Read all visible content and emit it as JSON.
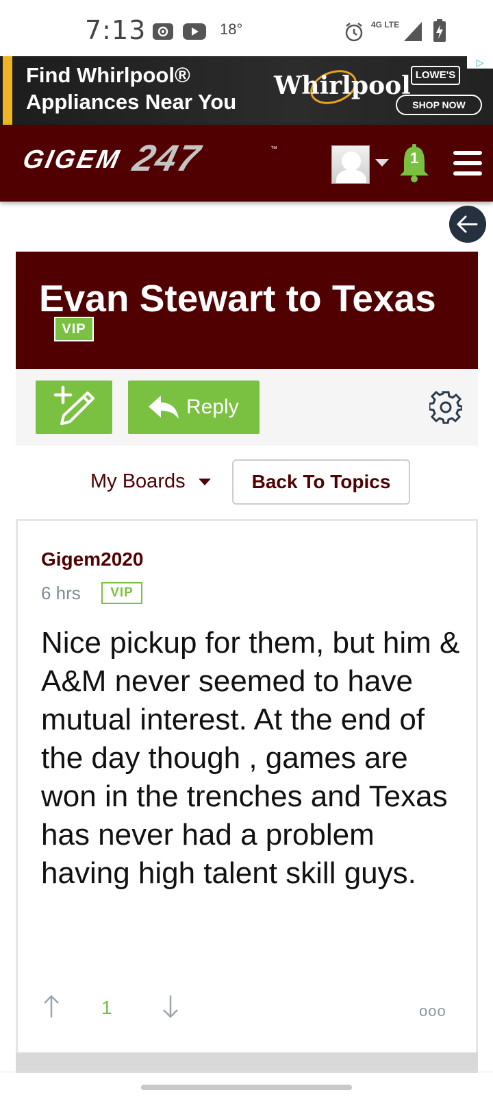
{
  "status_bar": {
    "time": "7:13",
    "temperature": "18°",
    "network": "4G LTE"
  },
  "ad": {
    "headline_line1": "Find Whirlpool®",
    "headline_line2": "Appliances Near You",
    "brand": "Whirlpool",
    "retailer": "LOWE'S",
    "cta": "SHOP NOW",
    "stripe_color": "#f0b323"
  },
  "header": {
    "logo_text": "GIGEM",
    "logo_number": "247",
    "notification_count": "1",
    "brand_color": "#500000"
  },
  "topic": {
    "title": "Evan Stewart to Texas",
    "badge": "VIP"
  },
  "toolbar": {
    "reply_label": "Reply",
    "accent_color": "#7ac142"
  },
  "nav": {
    "my_boards_label": "My Boards",
    "back_to_topics_label": "Back To Topics"
  },
  "post": {
    "author": "Gigem2020",
    "time": "6 hrs",
    "badge": "VIP",
    "body": "Nice pickup for them, but him & A&M never seemed to have mutual interest. At the end of the day though , games are won in the trenches and Texas has never had a problem having high talent skill guys.",
    "vote_count": "1",
    "more_label": "ooo"
  }
}
